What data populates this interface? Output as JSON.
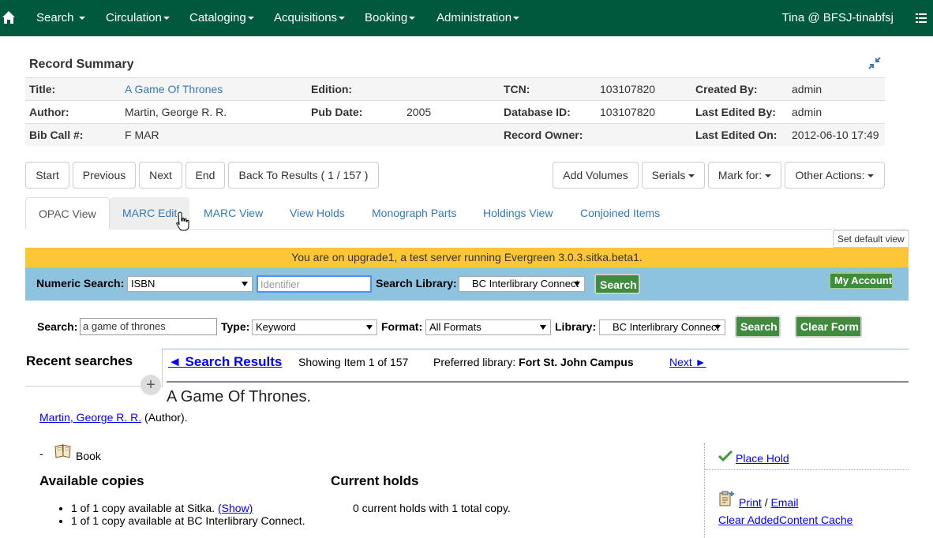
{
  "navbar": {
    "home_icon": "home-icon",
    "menus": [
      "Search",
      "Circulation",
      "Cataloging",
      "Acquisitions",
      "Booking",
      "Administration"
    ],
    "user": "Tina @ BFSJ-tinabfsj",
    "list_icon": "list-icon",
    "bg_color": "#00593d"
  },
  "summary": {
    "title": "Record Summary",
    "rows": [
      [
        {
          "label": "Title:",
          "value": "A Game Of Thrones"
        },
        {
          "label": "Edition:",
          "value": ""
        },
        {
          "label": "TCN:",
          "value": "103107820"
        },
        {
          "label": "Created By:",
          "value": "admin"
        }
      ],
      [
        {
          "label": "Author:",
          "value": "Martin, George R. R."
        },
        {
          "label": "Pub Date:",
          "value": "2005"
        },
        {
          "label": "Database ID:",
          "value": "103107820"
        },
        {
          "label": "Last Edited By:",
          "value": "admin"
        }
      ],
      [
        {
          "label": "Bib Call #:",
          "value": "F MAR"
        },
        {
          "label": "",
          "value": ""
        },
        {
          "label": "Record Owner:",
          "value": ""
        },
        {
          "label": "Last Edited On:",
          "value": "2012-06-10 17:49"
        }
      ]
    ]
  },
  "record_nav": {
    "start": "Start",
    "previous": "Previous",
    "next": "Next",
    "end": "End",
    "back": "Back To Results ( 1 / 157 )",
    "add_volumes": "Add Volumes",
    "serials": "Serials",
    "mark_for": "Mark for:",
    "other_actions": "Other Actions:"
  },
  "tabs": [
    "OPAC View",
    "MARC Edit",
    "MARC View",
    "View Holds",
    "Monograph Parts",
    "Holdings View",
    "Conjoined Items"
  ],
  "set_default_view": "Set default view",
  "banner": "You are on upgrade1, a test server running Evergreen 3.0.3.sitka.beta1.",
  "numeric_search": {
    "label": "Numeric Search:",
    "type_value": "ISBN",
    "placeholder": "Identifier",
    "library_label": "Search Library:",
    "library_value": "BC Interlibrary Connect",
    "search_button": "Search",
    "my_account": "My Account"
  },
  "search": {
    "label": "Search:",
    "query": "a game of thrones",
    "type_label": "Type:",
    "type_value": "Keyword",
    "format_label": "Format:",
    "format_value": "All Formats",
    "library_label": "Library:",
    "library_value": "BC Interlibrary Connect",
    "search_button": "Search",
    "clear_button": "Clear Form"
  },
  "results": {
    "recent_searches": "Recent searches",
    "back_link": "◄ Search Results",
    "showing": "Showing Item 1 of 157",
    "preferred_label": "Preferred library:",
    "preferred_value": "Fort St. John Campus",
    "next_link": "Next ►"
  },
  "record": {
    "title": "A Game Of Thrones.",
    "author_link": "Martin, George R. R.",
    "author_role": "(Author).",
    "format_dash": "-",
    "format": "Book",
    "available_heading": "Available copies",
    "copies": [
      {
        "text": "1 of 1 copy available at Sitka.",
        "link": "(Show)"
      },
      {
        "text": "1 of 1 copy available at BC Interlibrary Connect.",
        "link": ""
      }
    ],
    "holds_heading": "Current holds",
    "holds_text": "0 current holds with 1 total copy.",
    "place_hold": "Place Hold",
    "print": "Print",
    "slash": "/",
    "email": "Email",
    "clear_cache": "Clear AddedContent Cache"
  }
}
